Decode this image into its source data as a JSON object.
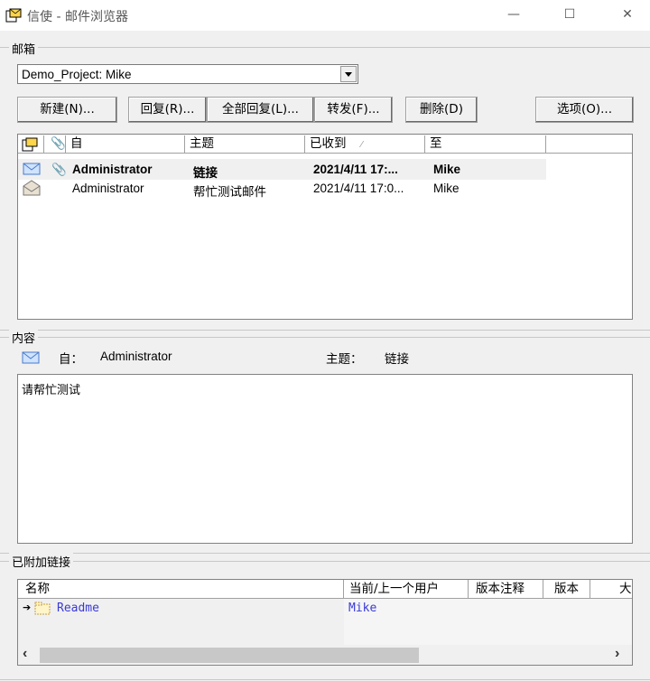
{
  "window": {
    "title": "信使 - 邮件浏览器",
    "minimize_glyph": "—",
    "maximize_glyph": "☐",
    "close_glyph": "✕"
  },
  "mailbox": {
    "group_label": "邮箱",
    "selected": "Demo_Project: Mike",
    "buttons": {
      "new": "新建(N)...",
      "reply": "回复(R)...",
      "reply_all": "全部回复(L)...",
      "forward": "转发(F)...",
      "delete": "删除(D)",
      "options": "选项(O)..."
    },
    "columns": {
      "from": "自",
      "subject": "主题",
      "received": "已收到",
      "to": "至"
    },
    "rows": [
      {
        "from": "Administrator",
        "subject": "链接",
        "received": "2021/4/11 17:...",
        "to": "Mike",
        "read": false,
        "attachment": true
      },
      {
        "from": "Administrator",
        "subject": "帮忙测试邮件",
        "received": "2021/4/11 17:0...",
        "to": "Mike",
        "read": true,
        "attachment": false
      }
    ]
  },
  "content": {
    "group_label": "内容",
    "from_label": "自：",
    "from_value": "Administrator",
    "subject_label": "主题：",
    "subject_value": "链接",
    "body": "请帮忙测试"
  },
  "attachments": {
    "group_label": "已附加链接",
    "columns": {
      "name": "名称",
      "current_user": "当前/上一个用户",
      "version_note": "版本注释",
      "version": "版本",
      "more": "大"
    },
    "rows": [
      {
        "name": "Readme",
        "current_user": "Mike"
      }
    ],
    "link_color": "#3a3ad8",
    "scroll_left": "‹",
    "scroll_right": "›"
  }
}
